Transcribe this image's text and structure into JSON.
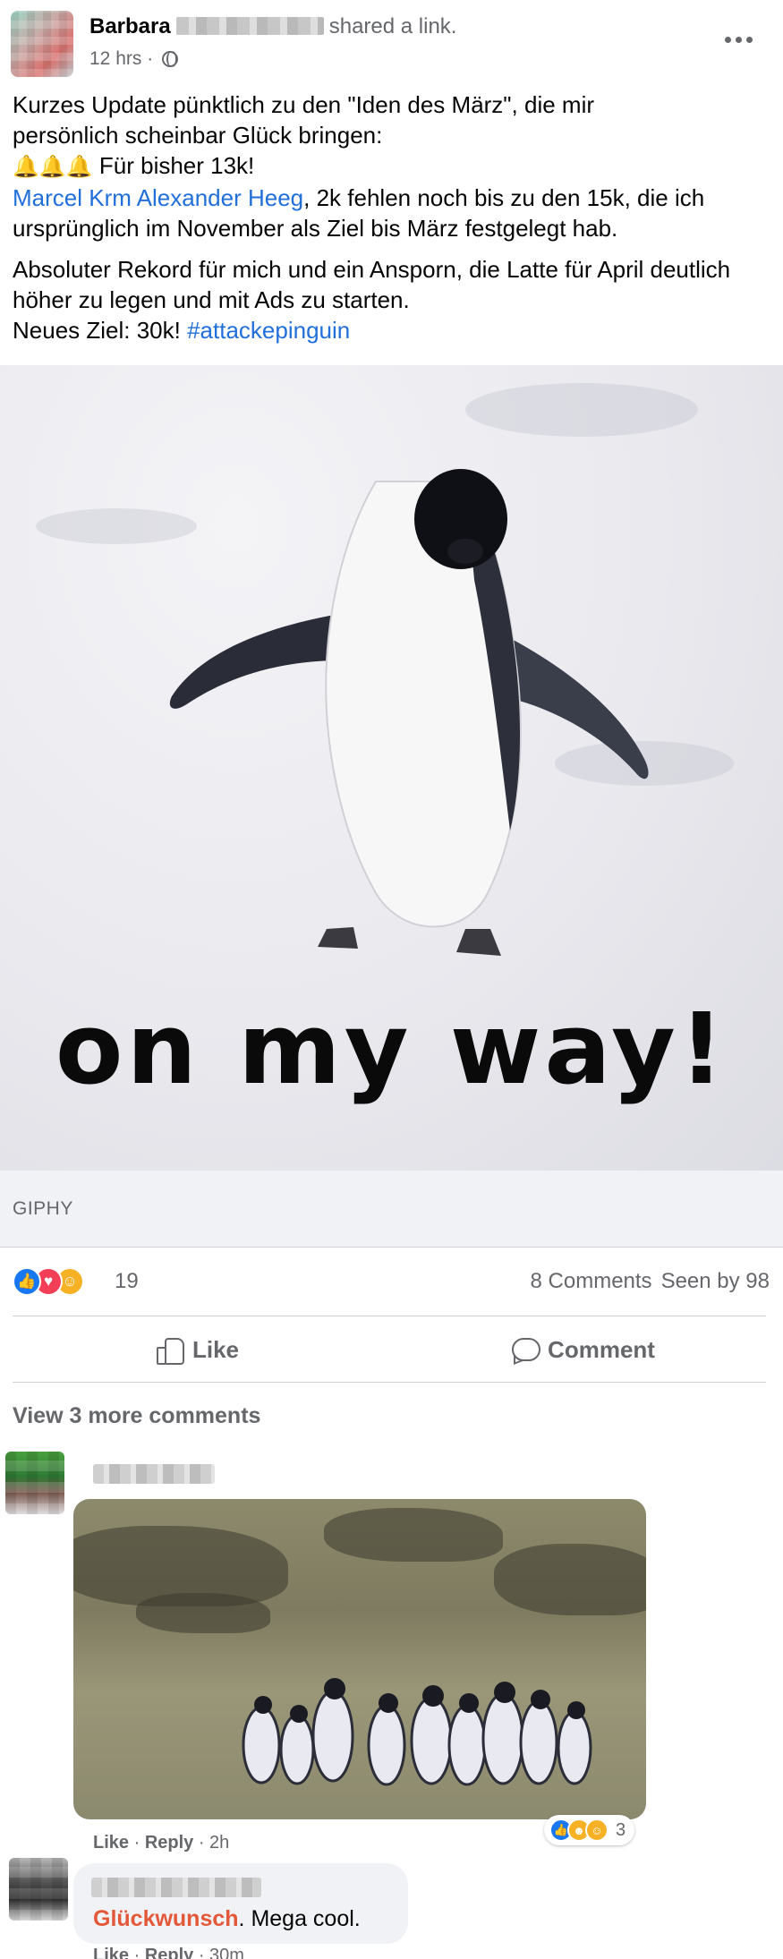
{
  "post": {
    "author": "Barbara",
    "action": "shared a link.",
    "time": "12 hrs ·",
    "paragraph1_line1": "Kurzes Update pünktlich zu den \"Iden des März\", die mir",
    "paragraph1_line2": "persönlich scheinbar Glück bringen:",
    "bells": "🔔🔔🔔",
    "goal_line": " Für bisher 13k!",
    "mention": "Marcel Krm Alexander Heeg",
    "mention_rest": ", 2k fehlen noch bis zu den 15k, die ich ursprünglich im November als Ziel bis März festgelegt hab.",
    "paragraph2": "Absoluter Rekord für mich und ein Ansporn, die Latte für April deutlich höher zu legen und mit Ads zu starten.",
    "new_goal": "Neues Ziel: 30k! ",
    "hashtag": "#attackepinguin"
  },
  "media": {
    "caption": "on my way!",
    "source": "GIPHY"
  },
  "stats": {
    "reaction_count": "19",
    "comments": "8 Comments",
    "seen": "Seen by 98"
  },
  "actions": {
    "like": "Like",
    "comment": "Comment"
  },
  "comments": {
    "view_more": "View 3 more comments",
    "c1": {
      "reaction_count": "3",
      "like": "Like",
      "reply": "Reply",
      "time": "· 2h",
      "sep": " · "
    },
    "c2": {
      "mention": "Glückwunsch",
      "text": ". Mega cool.",
      "like": "Like",
      "reply": "Reply",
      "time": "· 30m",
      "sep": " · "
    }
  },
  "icons": {
    "like": "like-reaction",
    "love": "love-reaction",
    "care": "care-reaction",
    "haha": "haha-reaction"
  },
  "colors": {
    "link": "#216fdb",
    "muted": "#65676b",
    "like_blue": "#1877f2",
    "love_red": "#f33e58",
    "mention_orange": "#e4583a"
  }
}
